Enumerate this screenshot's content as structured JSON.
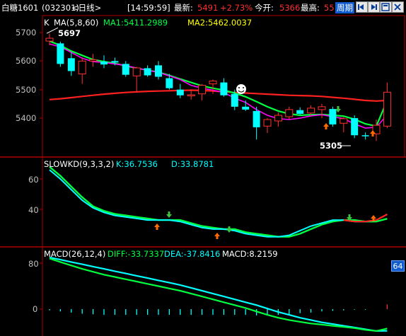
{
  "header": {
    "symbol_name": "白糖1601",
    "symbol_code": "(032301)",
    "period": "<日线>",
    "time": "[14:59:59]",
    "latest_label": "最新:",
    "latest_value": "5491",
    "change_pct": "+2.73%",
    "open_label": "今开:",
    "open_value": "5366",
    "high_label": "最高:",
    "high_value": "55",
    "cycle_button": "周期",
    "colors": {
      "up": "#ff3030",
      "down": "#00ffff",
      "label": "#ffffff",
      "accent": "#ffff00"
    }
  },
  "toolbar_icons": [
    "prev-page-icon",
    "next-page-icon",
    "zoom-icon",
    "close-icon"
  ],
  "main_panel": {
    "k_label": "K",
    "ma_label": "MA(5,8,60)",
    "ma1_label": "MA1:5411.2989",
    "ma2_label": "MA2:5462.0037",
    "high_marker": "5697",
    "low_marker": "5305",
    "y_ticks": [
      "5700",
      "5600",
      "5500",
      "5400"
    ]
  },
  "kd_panel": {
    "label": "SLOWKD(9,3,3,2)",
    "k_value": "K:36.7536",
    "d_value": "D:33.8781",
    "y_ticks": [
      "60",
      "40"
    ]
  },
  "macd_panel": {
    "label": "MACD(26,12,4)",
    "diff": "DIFF:-33.7337",
    "dea": "DEA:-37.8416",
    "macd": "MACD:8.2159",
    "y_ticks": [
      "80",
      "0"
    ],
    "side_badge": "64"
  },
  "chart_data": {
    "type": "candlestick",
    "candles": [
      {
        "o": 5670,
        "h": 5697,
        "l": 5655,
        "c": 5680
      },
      {
        "o": 5662,
        "h": 5668,
        "l": 5580,
        "c": 5590
      },
      {
        "o": 5610,
        "h": 5630,
        "l": 5548,
        "c": 5565
      },
      {
        "o": 5555,
        "h": 5610,
        "l": 5520,
        "c": 5600
      },
      {
        "o": 5600,
        "h": 5625,
        "l": 5580,
        "c": 5605
      },
      {
        "o": 5598,
        "h": 5620,
        "l": 5575,
        "c": 5588
      },
      {
        "o": 5600,
        "h": 5612,
        "l": 5585,
        "c": 5595
      },
      {
        "o": 5590,
        "h": 5600,
        "l": 5545,
        "c": 5552
      },
      {
        "o": 5548,
        "h": 5580,
        "l": 5490,
        "c": 5576
      },
      {
        "o": 5575,
        "h": 5585,
        "l": 5545,
        "c": 5550
      },
      {
        "o": 5585,
        "h": 5600,
        "l": 5535,
        "c": 5545
      },
      {
        "o": 5540,
        "h": 5555,
        "l": 5500,
        "c": 5505
      },
      {
        "o": 5500,
        "h": 5520,
        "l": 5470,
        "c": 5480
      },
      {
        "o": 5478,
        "h": 5500,
        "l": 5465,
        "c": 5482
      },
      {
        "o": 5485,
        "h": 5520,
        "l": 5462,
        "c": 5515
      },
      {
        "o": 5520,
        "h": 5535,
        "l": 5485,
        "c": 5530
      },
      {
        "o": 5525,
        "h": 5540,
        "l": 5475,
        "c": 5480
      },
      {
        "o": 5485,
        "h": 5500,
        "l": 5428,
        "c": 5440
      },
      {
        "o": 5440,
        "h": 5462,
        "l": 5425,
        "c": 5430
      },
      {
        "o": 5425,
        "h": 5440,
        "l": 5325,
        "c": 5368
      },
      {
        "o": 5372,
        "h": 5400,
        "l": 5348,
        "c": 5395
      },
      {
        "o": 5390,
        "h": 5420,
        "l": 5370,
        "c": 5410
      },
      {
        "o": 5405,
        "h": 5440,
        "l": 5395,
        "c": 5430
      },
      {
        "o": 5428,
        "h": 5438,
        "l": 5410,
        "c": 5415
      },
      {
        "o": 5418,
        "h": 5445,
        "l": 5410,
        "c": 5435
      },
      {
        "o": 5430,
        "h": 5450,
        "l": 5400,
        "c": 5440
      },
      {
        "o": 5432,
        "h": 5440,
        "l": 5370,
        "c": 5378
      },
      {
        "o": 5382,
        "h": 5405,
        "l": 5350,
        "c": 5398
      },
      {
        "o": 5400,
        "h": 5410,
        "l": 5330,
        "c": 5340
      },
      {
        "o": 5340,
        "h": 5350,
        "l": 5325,
        "c": 5338
      },
      {
        "o": 5345,
        "h": 5395,
        "l": 5320,
        "c": 5375
      },
      {
        "o": 5372,
        "h": 5525,
        "l": 5365,
        "c": 5491
      }
    ],
    "ma1": [
      5660,
      5650,
      5630,
      5610,
      5598,
      5595,
      5590,
      5585,
      5575,
      5568,
      5560,
      5548,
      5535,
      5515,
      5505,
      5498,
      5490,
      5470,
      5455,
      5430,
      5410,
      5398,
      5395,
      5400,
      5408,
      5412,
      5405,
      5398,
      5380,
      5365,
      5368,
      5411.3
    ],
    "ma2": [
      5670,
      5655,
      5635,
      5620,
      5605,
      5598,
      5592,
      5583,
      5575,
      5568,
      5561,
      5550,
      5537,
      5525,
      5513,
      5505,
      5498,
      5488,
      5475,
      5458,
      5440,
      5425,
      5415,
      5410,
      5412,
      5413,
      5410,
      5407,
      5396,
      5380,
      5372,
      5462.0
    ],
    "ma60": [
      5465,
      5468,
      5472,
      5476,
      5480,
      5484,
      5487,
      5490,
      5492,
      5494,
      5495,
      5496,
      5497,
      5498,
      5497,
      5495,
      5492,
      5490,
      5488,
      5486,
      5484,
      5482,
      5480,
      5479,
      5478,
      5476,
      5473,
      5470,
      5466,
      5462,
      5460,
      5462
    ],
    "kd_k": [
      66,
      60,
      53,
      46,
      41,
      38,
      36,
      35,
      34,
      33,
      33,
      33,
      32,
      30,
      28,
      27,
      27,
      26,
      24,
      23,
      22,
      22,
      23,
      26,
      29,
      31,
      33,
      33,
      32,
      32,
      33,
      36.75
    ],
    "kd_d": [
      68,
      62,
      55,
      48,
      42,
      39,
      37,
      36,
      35,
      34,
      33,
      33,
      33,
      31,
      29,
      28,
      27,
      27,
      25,
      24,
      23,
      22,
      22,
      24,
      27,
      30,
      32,
      33,
      33,
      32,
      32,
      33.88
    ],
    "macd_diff": [
      88,
      82,
      76,
      70,
      65,
      60,
      56,
      52,
      48,
      44,
      40,
      36,
      32,
      27,
      22,
      17,
      12,
      7,
      2,
      -4,
      -10,
      -15,
      -19,
      -22,
      -25,
      -27,
      -29,
      -31,
      -33,
      -36,
      -38,
      -33.73
    ],
    "macd_dea": [
      90,
      86,
      82,
      78,
      74,
      70,
      66,
      62,
      58,
      54,
      50,
      46,
      42,
      37,
      32,
      27,
      22,
      17,
      12,
      7,
      1,
      -5,
      -10,
      -15,
      -19,
      -23,
      -26,
      -29,
      -32,
      -35,
      -38,
      -37.84
    ],
    "macd_hist": [
      -2,
      -4,
      -6,
      -8,
      -9,
      -10,
      -10,
      -10,
      -10,
      -10,
      -10,
      -10,
      -10,
      -10,
      -10,
      -10,
      -10,
      -10,
      -10,
      -11,
      -11,
      -10,
      -9,
      -7,
      -6,
      -4,
      -3,
      -2,
      -1,
      -1,
      0,
      8.2
    ]
  }
}
